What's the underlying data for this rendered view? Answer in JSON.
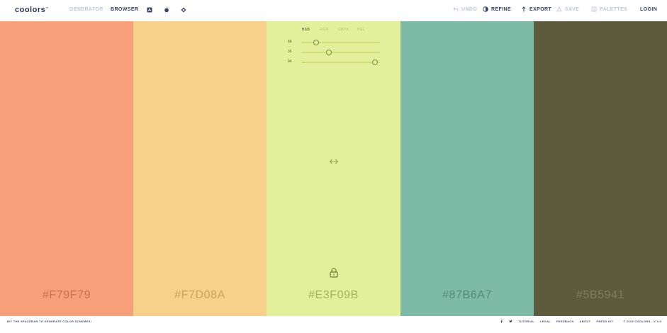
{
  "header": {
    "logo": "coolors",
    "logo_mark": "™",
    "nav": {
      "generator": "GENERATOR",
      "browser": "BROWSER"
    },
    "nav_icons": [
      "app-store-icon",
      "apple-icon",
      "chrome-extension-icon"
    ],
    "tools": {
      "undo": "UNDO",
      "refine": "REFINE",
      "export": "EXPORT",
      "save": "SAVE",
      "palettes": "PALETTES"
    },
    "login": "LOGIN"
  },
  "palette": {
    "swatches": [
      {
        "hex": "#F79F79",
        "color": "#F79F79",
        "text_color": "#c8724f"
      },
      {
        "hex": "#F7D08A",
        "color": "#F7D08A",
        "text_color": "#c9a35e"
      },
      {
        "hex": "#E3F09B",
        "color": "#E3F09B",
        "text_color": "#a7b05f"
      },
      {
        "hex": "#87B6A7",
        "color": "#7EBBA7",
        "text_color": "#54897a"
      },
      {
        "hex": "#5B5941",
        "color": "#5E5B3D",
        "text_color": "#7f7c5d"
      }
    ],
    "adjust": {
      "tabs": [
        "HSB",
        "RGB",
        "CMYK",
        "HSL"
      ],
      "active_tab": "HSB",
      "sliders": [
        {
          "label": "68",
          "fraction": 0.19
        },
        {
          "label": "35",
          "fraction": 0.35
        },
        {
          "label": "94",
          "fraction": 0.94
        }
      ]
    }
  },
  "footer": {
    "hint": "HIT THE SPACEBAR TO GENERATE COLOR SCHEMES!",
    "social_icons": [
      "facebook-icon",
      "twitter-icon"
    ],
    "links": [
      "TUTORIAL",
      "LEGAL",
      "FEEDBACK",
      "ABOUT",
      "PRESS KIT"
    ],
    "copyright": "© 2015 COOLORS - V 3.0"
  }
}
